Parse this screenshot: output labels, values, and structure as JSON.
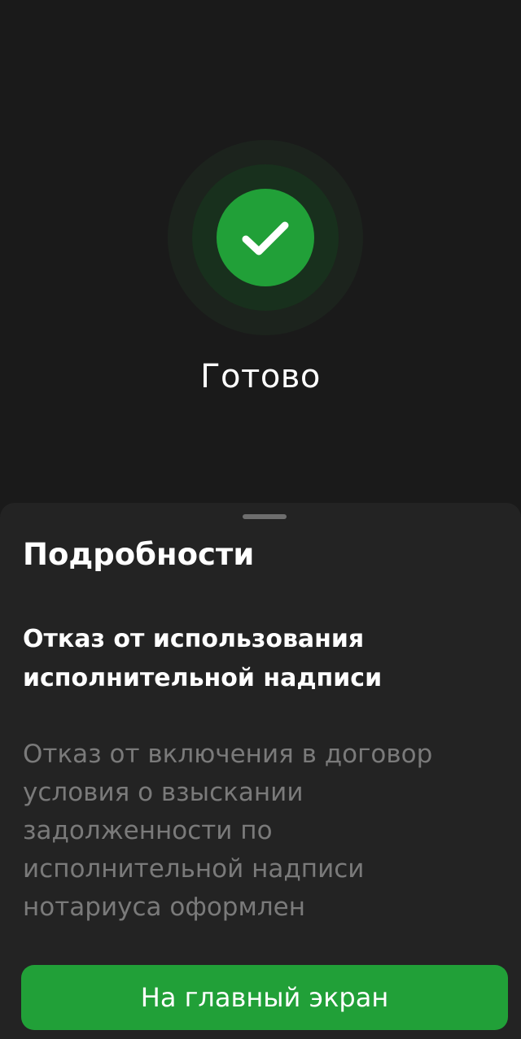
{
  "status": {
    "icon": "checkmark-icon",
    "title": "Готово",
    "accent_color": "#21a038"
  },
  "details_sheet": {
    "title": "Подробности",
    "item_title": "Отказ от использования исполнительной надписи",
    "item_description": "Отказ от включения в договор условия о взыскании задолженности по исполнительной надписи нотариуса оформлен"
  },
  "actions": {
    "home_button_label": "На главный экран"
  }
}
